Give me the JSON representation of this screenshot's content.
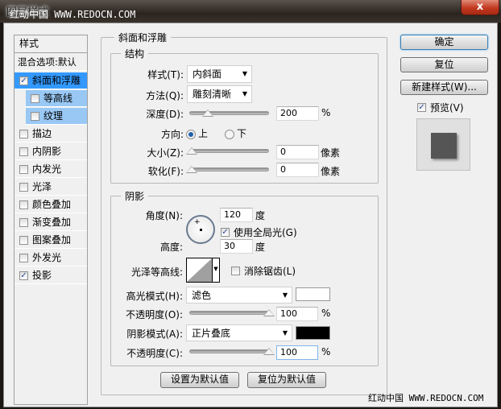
{
  "window": {
    "title": "图层样式",
    "close_label": "x"
  },
  "watermark": {
    "top": "红动中国 WWW.REDOCN.COM",
    "bottom": "红动中国 WWW.REDOCN.COM"
  },
  "sidebar": {
    "header": "样式",
    "blend_options": "混合选项:默认",
    "items": [
      {
        "label": "斜面和浮雕",
        "checked": true,
        "selected": true
      },
      {
        "label": "等高线",
        "checked": false,
        "sub": true
      },
      {
        "label": "纹理",
        "checked": false,
        "sub": true
      },
      {
        "label": "描边",
        "checked": false
      },
      {
        "label": "内阴影",
        "checked": false
      },
      {
        "label": "内发光",
        "checked": false
      },
      {
        "label": "光泽",
        "checked": false
      },
      {
        "label": "颜色叠加",
        "checked": false
      },
      {
        "label": "渐变叠加",
        "checked": false
      },
      {
        "label": "图案叠加",
        "checked": false
      },
      {
        "label": "外发光",
        "checked": false
      },
      {
        "label": "投影",
        "checked": true
      }
    ]
  },
  "main": {
    "group_title": "斜面和浮雕",
    "structure": {
      "title": "结构",
      "style_label": "样式(T):",
      "style_value": "内斜面",
      "method_label": "方法(Q):",
      "method_value": "雕刻清晰",
      "depth_label": "深度(D):",
      "depth_value": "200",
      "depth_unit": "%",
      "direction_label": "方向:",
      "dir_up": "上",
      "dir_down": "下",
      "direction_selected": "上",
      "size_label": "大小(Z):",
      "size_value": "0",
      "size_unit": "像素",
      "soften_label": "软化(F):",
      "soften_value": "0",
      "soften_unit": "像素"
    },
    "shading": {
      "title": "阴影",
      "angle_label": "角度(N):",
      "angle_value": "120",
      "angle_unit": "度",
      "global_light_label": "使用全局光(G)",
      "global_light_checked": true,
      "altitude_label": "高度:",
      "altitude_value": "30",
      "altitude_unit": "度",
      "gloss_label": "光泽等高线:",
      "antialias_label": "消除锯齿(L)",
      "antialias_checked": false,
      "highlight_mode_label": "高光模式(H):",
      "highlight_mode_value": "滤色",
      "highlight_color": "#ffffff",
      "highlight_opacity_label": "不透明度(O):",
      "highlight_opacity_value": "100",
      "highlight_opacity_unit": "%",
      "shadow_mode_label": "阴影模式(A):",
      "shadow_mode_value": "正片叠底",
      "shadow_color": "#000000",
      "shadow_opacity_label": "不透明度(C):",
      "shadow_opacity_value": "100",
      "shadow_opacity_unit": "%"
    },
    "make_default": "设置为默认值",
    "reset_default": "复位为默认值"
  },
  "actions": {
    "ok": "确定",
    "reset": "复位",
    "new_style": "新建样式(W)...",
    "preview_label": "预览(V)",
    "preview_checked": true
  },
  "colors": {
    "selected": "#3399ff",
    "sub_selected": "#99c8f5",
    "preview_swatch": "#555555"
  }
}
